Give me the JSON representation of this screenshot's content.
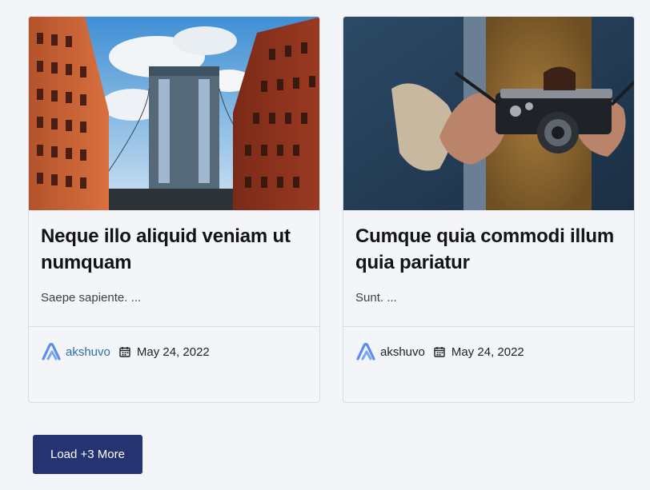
{
  "posts": [
    {
      "title": "Neque illo aliquid veniam ut numquam",
      "excerpt": "Saepe sapiente. ...",
      "author": "akshuvo",
      "date": "May 24, 2022",
      "image": "city-bridge-photo"
    },
    {
      "title": "Cumque quia commodi illum quia pariatur",
      "excerpt": "Sunt. ...",
      "author": "akshuvo",
      "date": "May 24, 2022",
      "image": "camera-hands-photo"
    }
  ],
  "load_more": {
    "label": "Load +3 More"
  },
  "colors": {
    "background": "#f4f5f8",
    "button": "#253371",
    "author_link": "#2c6fb0",
    "border": "#d9dce3"
  }
}
